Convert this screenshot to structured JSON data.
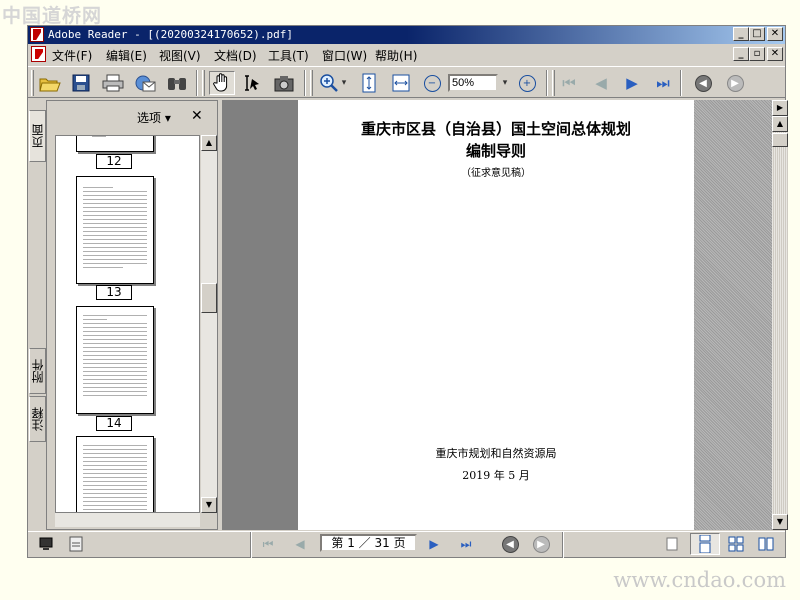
{
  "watermark": {
    "top": "中国道桥网",
    "bottom": "www.cndao.com"
  },
  "window": {
    "title": "Adobe Reader - [(20200324170652).pdf]"
  },
  "menu": {
    "items": [
      "文件(F)",
      "编辑(E)",
      "视图(V)",
      "文档(D)",
      "工具(T)",
      "窗口(W)",
      "帮助(H)"
    ]
  },
  "toolbar": {
    "zoom_value": "50%"
  },
  "side_tabs": {
    "pages": "页面",
    "attachments": "附件",
    "comments": "注释"
  },
  "thumbs_panel": {
    "options_label": "选项 ▾",
    "close_label": "✕",
    "page_labels": [
      "12",
      "13",
      "14"
    ]
  },
  "document": {
    "title_line1": "重庆市区县（自治县）国土空间总体规划",
    "title_line2": "编制导则",
    "subtitle": "（征求意见稿）",
    "organization": "重庆市规划和自然资源局",
    "date": "2019 年 5 月"
  },
  "status": {
    "page_indicator": "第 1 ／ 31 页"
  }
}
